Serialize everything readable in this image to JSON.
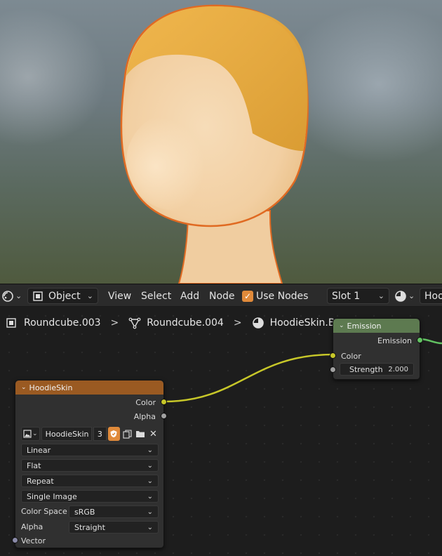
{
  "header": {
    "editor_type_icon": "node-editor-icon",
    "object_icon": "object-icon",
    "object_mode": "Object",
    "menus": [
      "View",
      "Select",
      "Add",
      "Node"
    ],
    "use_nodes_label": "Use Nodes",
    "use_nodes_checked": true,
    "slot": "Slot 1",
    "material_icon": "material-sphere-icon",
    "material_name_cut": "Hoo"
  },
  "breadcrumb": {
    "object": "Roundcube.003",
    "mesh": "Roundcube.004",
    "material": "HoodieSkin.Blog"
  },
  "emission_node": {
    "title": "Emission",
    "output": "Emission",
    "color_input": "Color",
    "strength_label": "Strength",
    "strength_value": "2.000",
    "header_color": "#5d7a50"
  },
  "image_node": {
    "title": "HoodieSkin",
    "header_color": "#9a5a22",
    "outputs": [
      "Color",
      "Alpha"
    ],
    "image_name": "HoodieSkin",
    "users": "3",
    "interpolation": "Linear",
    "projection": "Flat",
    "extension": "Repeat",
    "source": "Single Image",
    "color_space_label": "Color Space",
    "color_space_value": "sRGB",
    "alpha_label": "Alpha",
    "alpha_value": "Straight",
    "vector_input": "Vector"
  },
  "colors": {
    "accent_orange": "#e08a3a",
    "wire": "#c7c729",
    "skin_light": "#f3d4ab",
    "hair": "#e2a83e",
    "outline": "#e06a22"
  }
}
